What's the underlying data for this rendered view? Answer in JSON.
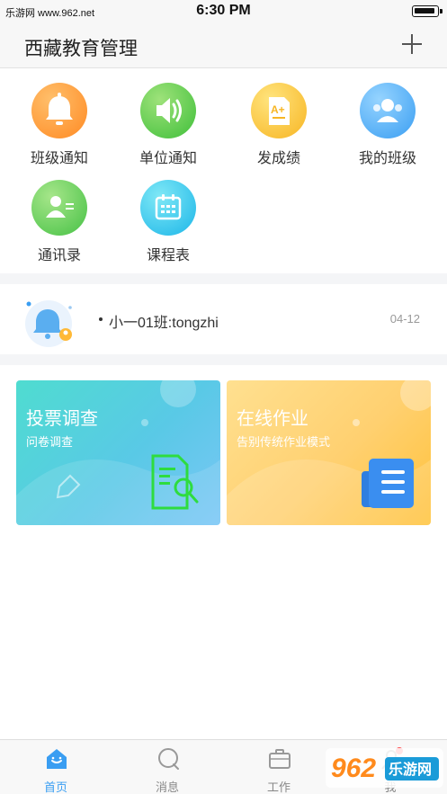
{
  "status_bar": {
    "carrier": "乐游网 www.962.net",
    "time": "6:30 PM"
  },
  "header": {
    "title": "西藏教育管理",
    "add_icon": "plus-icon"
  },
  "grid": [
    {
      "label": "班级通知",
      "icon": "bell-icon",
      "color": "#ff8a23"
    },
    {
      "label": "单位通知",
      "icon": "speaker-icon",
      "color": "#3fbf3a"
    },
    {
      "label": "发成绩",
      "icon": "grade-paper-icon",
      "color": "#f7b523"
    },
    {
      "label": "我的班级",
      "icon": "group-icon",
      "color": "#3a9ef2"
    },
    {
      "label": "通讯录",
      "icon": "contact-card-icon",
      "color": "#46c145"
    },
    {
      "label": "课程表",
      "icon": "calendar-icon",
      "color": "#1cb6e8"
    }
  ],
  "notice": {
    "text": "小一01班:tongzhi",
    "date": "04-12",
    "icon": "notice-bell-icon"
  },
  "cards": [
    {
      "title": "投票调查",
      "subtitle": "问卷调查",
      "icon": "document-search-icon"
    },
    {
      "title": "在线作业",
      "subtitle": "告别传统作业模式",
      "icon": "newspaper-icon"
    }
  ],
  "tabs": [
    {
      "label": "首页",
      "icon": "home-icon",
      "active": true
    },
    {
      "label": "消息",
      "icon": "chat-bubble-icon",
      "active": false
    },
    {
      "label": "工作",
      "icon": "briefcase-icon",
      "active": false
    },
    {
      "label": "我",
      "icon": "profile-icon",
      "active": false
    }
  ],
  "watermark": {
    "text": "962",
    "site": "乐游网"
  }
}
